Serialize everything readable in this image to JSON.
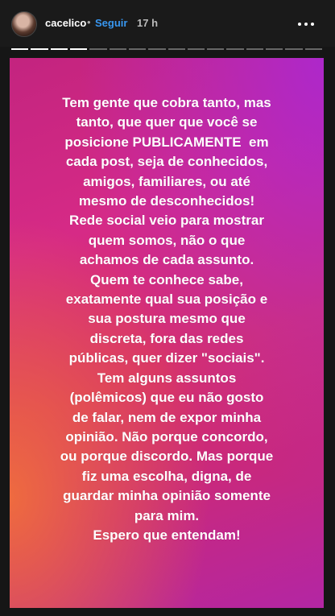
{
  "header": {
    "username": "cacelico",
    "separator": "•",
    "follow_label": "Seguir",
    "time": "17 h",
    "more_icon": "more-dots-icon"
  },
  "progress": {
    "segments_total": 16,
    "segments_done": 4
  },
  "story": {
    "lines": [
      "Tem gente que cobra tanto, mas",
      "tanto, que quer que você se",
      "posicione PUBLICAMENTE  em",
      "cada post, seja de conhecidos,",
      "amigos, familiares, ou até",
      "mesmo de desconhecidos!",
      "Rede social veio para mostrar",
      "quem somos, não o que",
      "achamos de cada assunto.",
      "Quem te conhece sabe,",
      "exatamente qual sua posição e",
      "sua postura mesmo que",
      "discreta, fora das redes",
      "públicas, quer dizer \"sociais\".",
      "Tem alguns assuntos",
      "(polêmicos) que eu não gosto",
      "de falar, nem de expor minha",
      "opinião. Não porque concordo,",
      "ou porque discordo. Mas porque",
      "fiz uma escolha, digna, de",
      "guardar minha opinião somente",
      "para mim.",
      "Espero que entendam!"
    ]
  }
}
